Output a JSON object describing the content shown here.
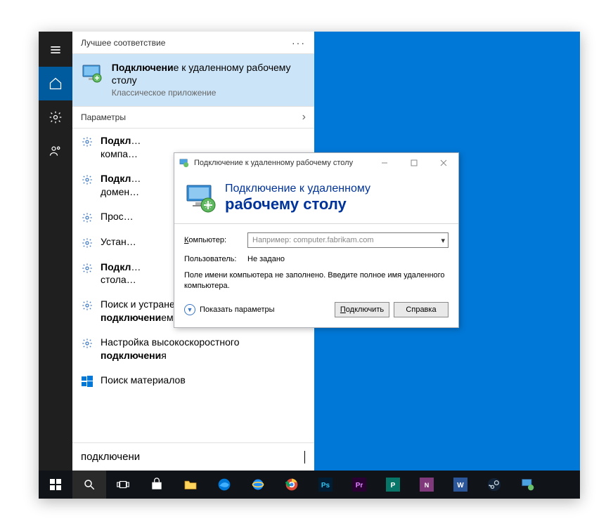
{
  "sidebar": {
    "items": [
      "menu",
      "home",
      "settings",
      "people"
    ]
  },
  "start": {
    "best_match_header": "Лучшее соответствие",
    "best_result": {
      "title_html": "<b>Подключени</b>е к удаленному рабочему столу",
      "sub": "Классическое приложение"
    },
    "settings_header": "Параметры",
    "results": [
      {
        "html": "<b>Подкл</b>…",
        "sub": "компа…"
      },
      {
        "html": "<b>Подкл</b>…",
        "sub": "домен…"
      },
      {
        "html": "Прос…"
      },
      {
        "html": "Устан…"
      },
      {
        "html": "<b>Подкл</b>…",
        "sub": "стола…"
      },
      {
        "html": "Поиск и устранение проблем с сетью и <b>подключени</b>ем"
      },
      {
        "html": "Настройка высокоскоростного <b>подключени</b>я"
      },
      {
        "html": "Поиск материалов",
        "store": true
      }
    ],
    "search_value": "подключени"
  },
  "rdp": {
    "title": "Подключение к удаленному рабочему столу",
    "banner_line1": "Подключение к удаленному",
    "banner_line2": "рабочему столу",
    "computer_label": "Компьютер:",
    "computer_placeholder": "Например: computer.fabrikam.com",
    "user_label": "Пользователь:",
    "user_value": "Не задано",
    "hint": "Поле имени компьютера не заполнено. Введите полное имя удаленного компьютера.",
    "show_options": "Показать параметры",
    "connect": "Подключить",
    "help": "Справка"
  },
  "taskbar": {
    "items": [
      "start",
      "search",
      "taskview",
      "store",
      "explorer",
      "edge",
      "ie",
      "chrome",
      "photoshop",
      "premiere",
      "publisher",
      "onenote",
      "word",
      "steam",
      "rdp"
    ]
  }
}
